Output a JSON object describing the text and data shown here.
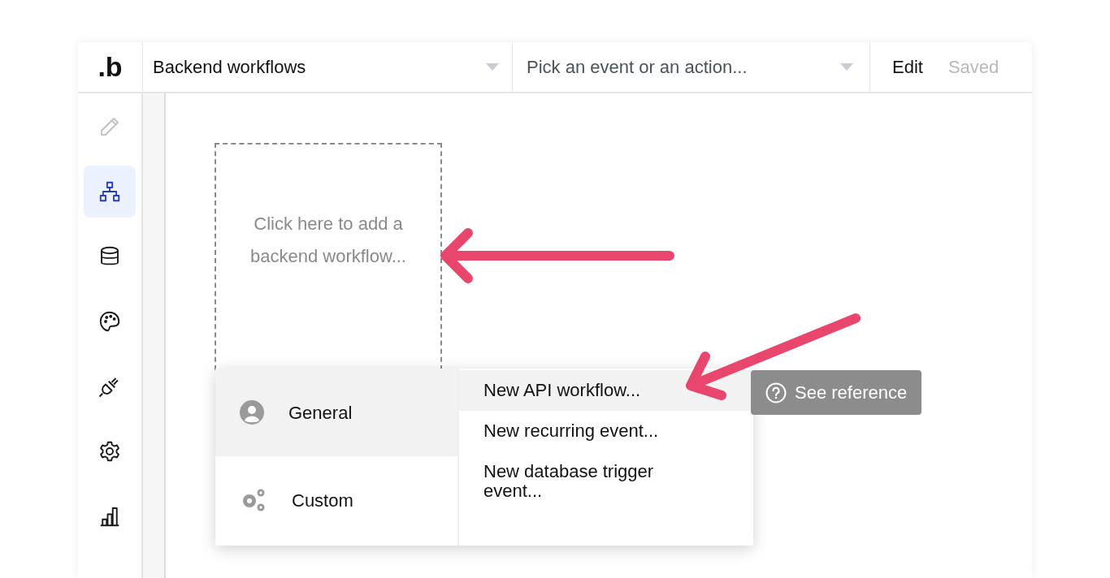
{
  "header": {
    "logo": ".b",
    "page_dropdown": {
      "value": "Backend workflows"
    },
    "event_dropdown": {
      "placeholder": "Pick an event or an action..."
    },
    "edit_button": "Edit",
    "save_status": "Saved"
  },
  "sidebar": {
    "items": [
      {
        "selected": false,
        "disabled": true
      },
      {
        "selected": true,
        "disabled": false
      },
      {
        "selected": false,
        "disabled": false
      },
      {
        "selected": false,
        "disabled": false
      },
      {
        "selected": false,
        "disabled": false
      },
      {
        "selected": false,
        "disabled": false
      },
      {
        "selected": false,
        "disabled": false
      }
    ]
  },
  "canvas": {
    "add_workflow_hint": "Click here to add a backend workflow..."
  },
  "menu": {
    "categories": [
      {
        "label": "General",
        "selected": true
      },
      {
        "label": "Custom",
        "selected": false
      }
    ],
    "options": [
      {
        "label": "New API workflow...",
        "highlighted": true
      },
      {
        "label": "New recurring event...",
        "highlighted": false
      },
      {
        "label": "New database trigger event...",
        "highlighted": false
      }
    ]
  },
  "reference_button": "See reference"
}
